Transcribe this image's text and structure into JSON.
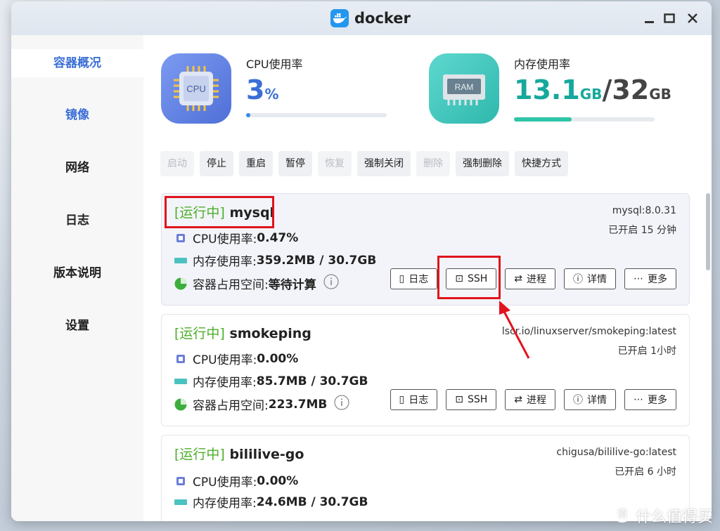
{
  "app": {
    "title": "docker",
    "icon": "docker-whale-icon",
    "brand_color": "#2496ed"
  },
  "sidebar": {
    "items": [
      {
        "label": "容器概况"
      },
      {
        "label": "镜像"
      },
      {
        "label": "网络"
      },
      {
        "label": "日志"
      },
      {
        "label": "版本说明"
      },
      {
        "label": "设置"
      }
    ]
  },
  "stats": {
    "cpu": {
      "chip_text": "CPU",
      "label": "CPU使用率",
      "value": "3",
      "unit": "%",
      "percent": 3
    },
    "ram": {
      "chip_text": "RAM",
      "label": "内存使用率",
      "used": "13.1",
      "used_unit": "GB",
      "sep": "/",
      "total": "32",
      "total_unit": "GB",
      "fraction": 0.41
    }
  },
  "toolbar": {
    "buttons": [
      {
        "label": "启动",
        "disabled": true
      },
      {
        "label": "停止",
        "disabled": false
      },
      {
        "label": "重启",
        "disabled": false
      },
      {
        "label": "暂停",
        "disabled": false
      },
      {
        "label": "恢复",
        "disabled": true
      },
      {
        "label": "强制关闭",
        "disabled": false
      },
      {
        "label": "删除",
        "disabled": true
      },
      {
        "label": "强制删除",
        "disabled": false
      },
      {
        "label": "快捷方式",
        "disabled": false
      }
    ]
  },
  "containers": [
    {
      "status": "[运行中]",
      "name": "mysql",
      "image": "mysql:8.0.31",
      "uptime": "已开启 15 分钟",
      "cpu_label": "CPU使用率:",
      "cpu": "0.47%",
      "mem_label": "内存使用率:",
      "mem": "359.2MB / 30.7GB",
      "disk_label": "容器占用空间:",
      "disk": "等待计算"
    },
    {
      "status": "[运行中]",
      "name": "smokeping",
      "image": "lscr.io/linuxserver/smokeping:latest",
      "uptime": "已开启 1小时",
      "cpu_label": "CPU使用率:",
      "cpu": "0.00%",
      "mem_label": "内存使用率:",
      "mem": "85.7MB / 30.7GB",
      "disk_label": "容器占用空间:",
      "disk": "223.7MB"
    },
    {
      "status": "[运行中]",
      "name": "bililive-go",
      "image": "chigusa/bililive-go:latest",
      "uptime": "已开启 6 小时",
      "cpu_label": "CPU使用率:",
      "cpu": "0.00%",
      "mem_label": "内存使用率:",
      "mem": "24.6MB / 30.7GB"
    }
  ],
  "card_actions": {
    "log": "日志",
    "ssh": "SSH",
    "process": "进程",
    "details": "详情",
    "more": "更多"
  },
  "watermark": {
    "text": "什么值得买",
    "icon": "zhi-logo-icon"
  }
}
